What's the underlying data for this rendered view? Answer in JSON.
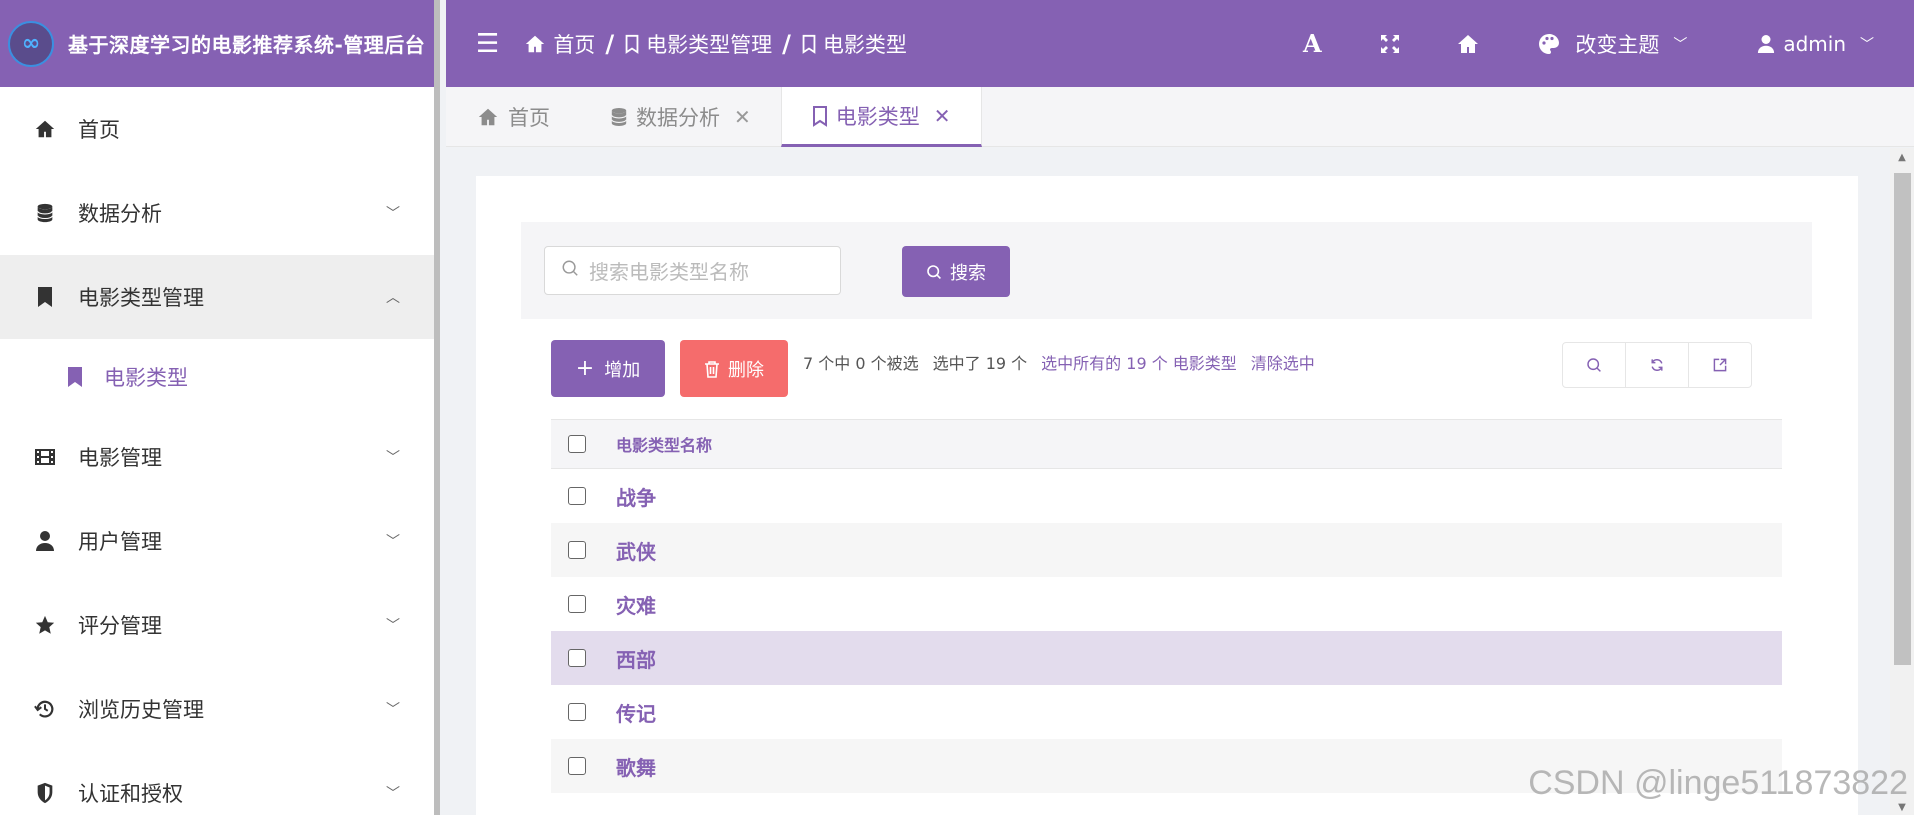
{
  "colors": {
    "primary": "#8561b3",
    "danger": "#f56c6c",
    "sidebar_bg": "#ffffff"
  },
  "brand": {
    "title": "基于深度学习的电影推荐系统-管理后台",
    "logo_icon": "infinity-logo"
  },
  "sidebar": {
    "items": [
      {
        "label": "首页",
        "icon": "home-icon",
        "expandable": false
      },
      {
        "label": "数据分析",
        "icon": "database-icon",
        "expandable": true,
        "expanded": false
      },
      {
        "label": "电影类型管理",
        "icon": "bookmark-icon",
        "expandable": true,
        "expanded": true,
        "children": [
          {
            "label": "电影类型",
            "icon": "bookmark-icon",
            "active": true
          }
        ]
      },
      {
        "label": "电影管理",
        "icon": "film-icon",
        "expandable": true,
        "expanded": false
      },
      {
        "label": "用户管理",
        "icon": "user-icon",
        "expandable": true,
        "expanded": false
      },
      {
        "label": "评分管理",
        "icon": "star-icon",
        "expandable": true,
        "expanded": false
      },
      {
        "label": "浏览历史管理",
        "icon": "history-icon",
        "expandable": true,
        "expanded": false
      },
      {
        "label": "认证和授权",
        "icon": "shield-icon",
        "expandable": true,
        "expanded": false
      }
    ]
  },
  "header": {
    "breadcrumb": [
      "首页",
      "电影类型管理",
      "电影类型"
    ],
    "breadcrumb_separator": "/",
    "theme_label": "改变主题",
    "user_label": "admin"
  },
  "tabs": [
    {
      "label": "首页",
      "closable": false,
      "active": false
    },
    {
      "label": "数据分析",
      "closable": true,
      "active": false
    },
    {
      "label": "电影类型",
      "closable": true,
      "active": true
    }
  ],
  "search": {
    "placeholder": "搜索电影类型名称",
    "value": "",
    "button_label": "搜索"
  },
  "actions": {
    "add_label": "增加",
    "delete_label": "删除"
  },
  "selection": {
    "summary": "7 个中 0 个被选",
    "selected": "选中了 19 个",
    "select_all": "选中所有的 19 个 电影类型",
    "clear": "清除选中"
  },
  "table": {
    "column": "电影类型名称",
    "rows": [
      "战争",
      "武侠",
      "灾难",
      "西部",
      "传记",
      "歌舞"
    ],
    "highlighted_row": "西部"
  },
  "watermark": "CSDN @linge511873822"
}
